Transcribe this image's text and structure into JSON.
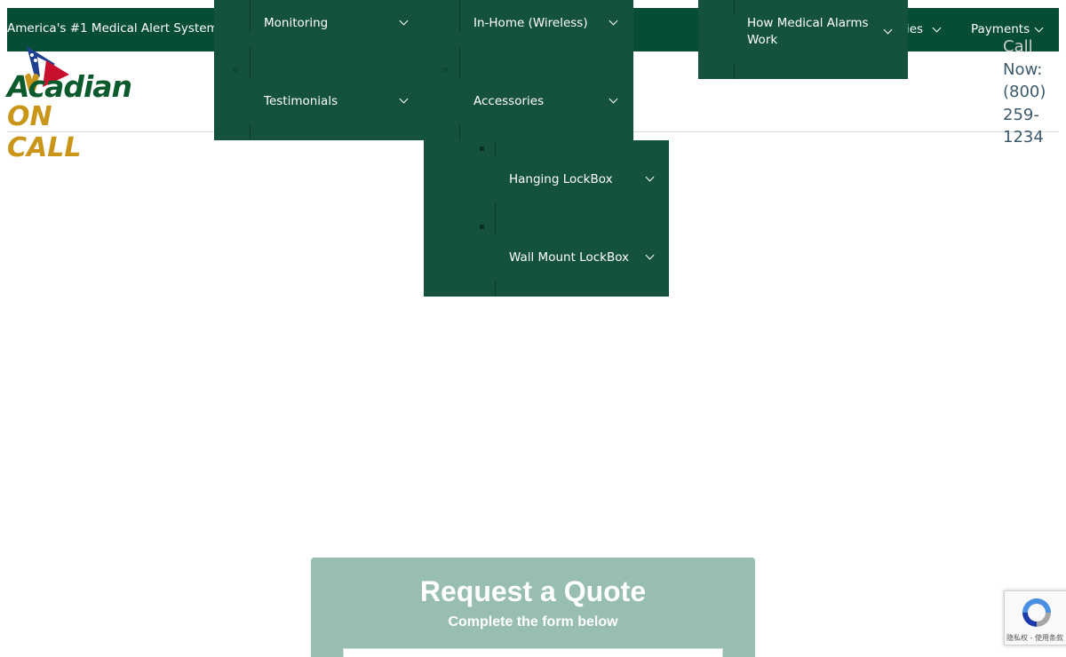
{
  "topbar": {
    "tagline": "America's #1 Medical Alert Systems",
    "nav_partial": "ies",
    "payments": "Payments"
  },
  "logo": {
    "line1": "Acadian",
    "line2": "ON CALL"
  },
  "callnow": {
    "label": "Call",
    "line2": "Now:",
    "line3": "(800)",
    "line4": "259-",
    "line5": "1234"
  },
  "menus": {
    "monitoring": "Monitoring",
    "testimonials": "Testimonials",
    "in_home": "In-Home (Wireless)",
    "accessories": "Accessories",
    "hanging_lockbox": "Hanging LockBox",
    "wall_mount_lockbox": "Wall Mount LockBox",
    "how_alarms_work_line1": "How Medical Alarms",
    "how_alarms_work_line2": "Work"
  },
  "quote": {
    "title": "Request a Quote",
    "subtitle": "Complete the form below"
  },
  "recaptcha": {
    "terms": "隐私权 - 使用条款"
  },
  "colors": {
    "topbar": "#074c36",
    "menu_panel": "#14523f",
    "quote_box": "#98bdb1",
    "logo_green": "#0b5a2b",
    "logo_gold": "#c9961a"
  }
}
